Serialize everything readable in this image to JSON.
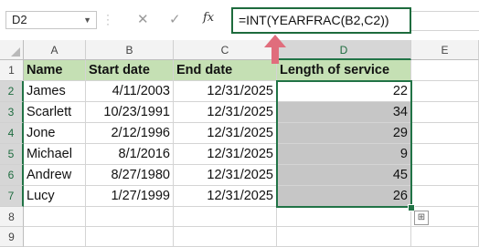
{
  "formula_bar": {
    "name_box": "D2",
    "cancel_icon": "✕",
    "enter_icon": "✓",
    "fx_label": "fx",
    "formula": "=INT(YEARFRAC(B2,C2))"
  },
  "columns": [
    "A",
    "B",
    "C",
    "D",
    "E"
  ],
  "rows": [
    "1",
    "2",
    "3",
    "4",
    "5",
    "6",
    "7",
    "8",
    "9"
  ],
  "table": {
    "headers": [
      "Name",
      "Start date",
      "End date",
      "Length of service"
    ],
    "records": [
      [
        "James",
        "4/11/2003",
        "12/31/2025",
        "22"
      ],
      [
        "Scarlett",
        "10/23/1991",
        "12/31/2025",
        "34"
      ],
      [
        "Jone",
        "2/12/1996",
        "12/31/2025",
        "29"
      ],
      [
        "Michael",
        "8/1/2016",
        "12/31/2025",
        "9"
      ],
      [
        "Andrew",
        "8/27/1980",
        "12/31/2025",
        "45"
      ],
      [
        "Lucy",
        "1/27/1999",
        "12/31/2025",
        "26"
      ]
    ]
  },
  "colors": {
    "header_fill": "#c5e0b4",
    "selection_fill": "#c6c6c6",
    "selection_border": "#217346",
    "arrow": "#e06d7c"
  }
}
